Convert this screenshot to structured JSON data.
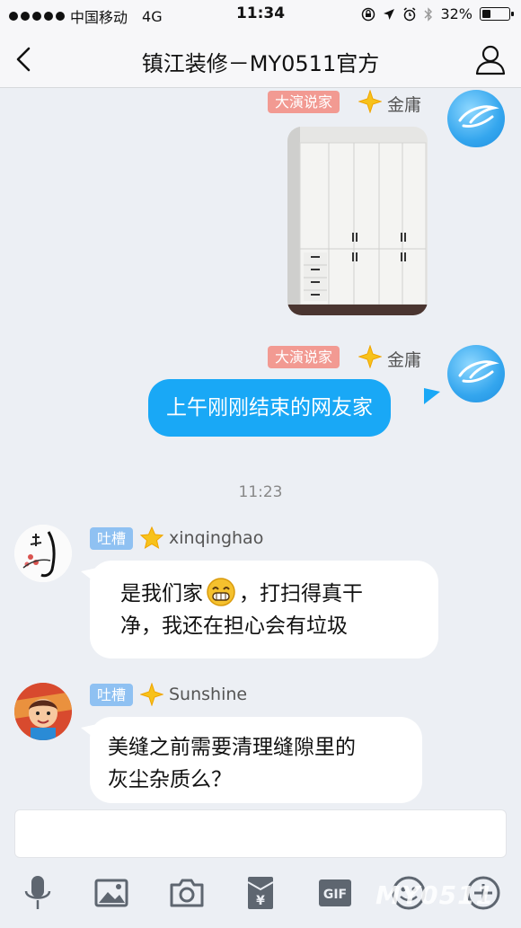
{
  "status_bar": {
    "carrier": "中国移动",
    "network": "4G",
    "time": "11:34",
    "battery": "32%",
    "battery_level": 0.32
  },
  "header": {
    "title": "镇江装修－MY0511官方"
  },
  "messages": [
    {
      "side": "right",
      "badge": "大演说家",
      "username": "金庸",
      "type": "image",
      "image_desc_icon": "photo-white-cabinet"
    },
    {
      "side": "right",
      "badge": "大演说家",
      "username": "金庸",
      "type": "text",
      "text": "上午刚刚结束的网友家"
    },
    {
      "side": "left",
      "badge": "吐槽",
      "username": "xinqinghao",
      "type": "text",
      "text_line1_a": "是我们家",
      "emoji": "grinning-face",
      "text_line1_b": "，打扫得真干",
      "text_line2": "净，我还在担心会有垃圾"
    },
    {
      "side": "left",
      "badge": "吐槽",
      "username": "Sunshine",
      "type": "text",
      "text_line1": "美缝之前需要清理缝隙里的",
      "text_line2": "灰尘杂质么？"
    }
  ],
  "divider_time": "11:23",
  "toolbar": {
    "icons": [
      "microphone-icon",
      "image-icon",
      "camera-icon",
      "red-envelope-icon",
      "gif-icon",
      "emoji-icon",
      "plus-icon"
    ],
    "gif_label": "GIF",
    "yen_symbol": "¥"
  },
  "colors": {
    "self_bubble": "#19a8f6",
    "other_bubble": "#ffffff",
    "badge_speaker": "#f29a92",
    "badge_complain": "#8fc1f2",
    "background": "#eceff4"
  },
  "watermark": "MY0511"
}
